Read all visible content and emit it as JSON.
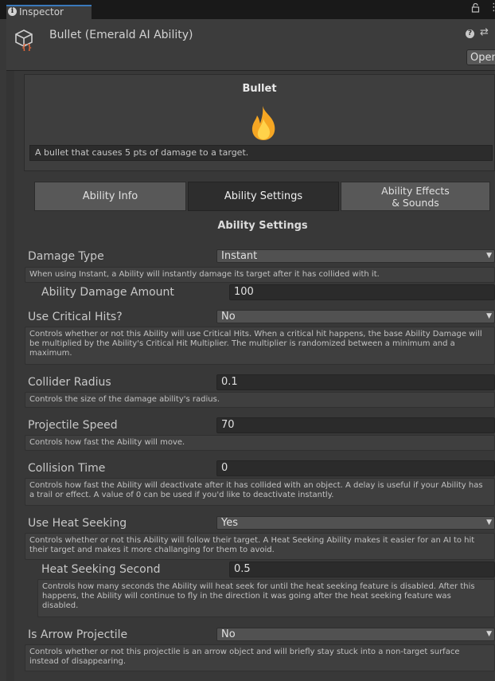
{
  "tab": {
    "label": "Inspector",
    "info_icon": "info-icon",
    "lock_icon": "lock-icon",
    "menu_icon": "kebab-menu-icon"
  },
  "header": {
    "title": "Bullet (Emerald AI Ability)",
    "asset_icon": "scriptable-object-icon",
    "help_icon": "help-icon",
    "preset_icon": "presets-icon",
    "open_label": "Open"
  },
  "ability": {
    "name": "Bullet",
    "icon": "flame-icon",
    "description": "A bullet that causes 5 pts of damage to a target."
  },
  "section_tabs": [
    {
      "label": "Ability Info",
      "selected": false
    },
    {
      "label": "Ability Settings",
      "selected": true
    },
    {
      "label": "Ability Effects\n& Sounds",
      "selected": false
    }
  ],
  "section_heading": "Ability Settings",
  "fields": {
    "damage_type": {
      "label": "Damage Type",
      "value": "Instant",
      "help": "When using Instant, a Ability will instantly damage its target after it has collided with it."
    },
    "damage_amount": {
      "label": "Ability Damage Amount",
      "value": "100"
    },
    "critical_hits": {
      "label": "Use Critical Hits?",
      "value": "No",
      "help": "Controls whether or not this Ability will use Critical Hits. When a critical hit happens, the base Ability Damage will be multiplied by the Ability's Critical Hit Multiplier. The multiplier is randomized between a minimum and a maximum."
    },
    "collider_radius": {
      "label": "Collider Radius",
      "value": "0.1",
      "help": "Controls the size of the damage ability's radius."
    },
    "projectile_speed": {
      "label": "Projectile Speed",
      "value": "70",
      "help": "Controls how fast the Ability will move."
    },
    "collision_time": {
      "label": "Collision Time",
      "value": "0",
      "help": "Controls how fast the Ability will deactivate after it has collided with an object. A delay is useful if your Ability has a trail or effect. A value of 0 can be used if you'd like to deactivate instantly."
    },
    "heat_seeking": {
      "label": "Use Heat Seeking",
      "value": "Yes",
      "help": "Controls whether or not this Ability will follow their target. A Heat Seeking Ability makes it easier for an AI to hit their target and makes it more challanging for them to avoid."
    },
    "heat_seeking_second": {
      "label": "Heat Seeking Second",
      "value": "0.5",
      "help": "Controls how many seconds the Ability will heat seek for until the heat seeking feature is disabled. After this happens, the Ability will continue to fly in the direction it was going after the heat seeking feature was disabled."
    },
    "arrow_projectile": {
      "label": "Is Arrow Projectile",
      "value": "No",
      "help": "Controls whether or not this projectile is an arrow object and will briefly stay stuck into a non-target surface instead of disappearing."
    }
  },
  "dropdown_caret_icon": "caret-down-icon",
  "colors": {
    "background": "#383838",
    "field": "#2b2b2b",
    "dropdown": "#515151",
    "tab_accent": "#3a79bb",
    "flame": "#f5a623"
  }
}
